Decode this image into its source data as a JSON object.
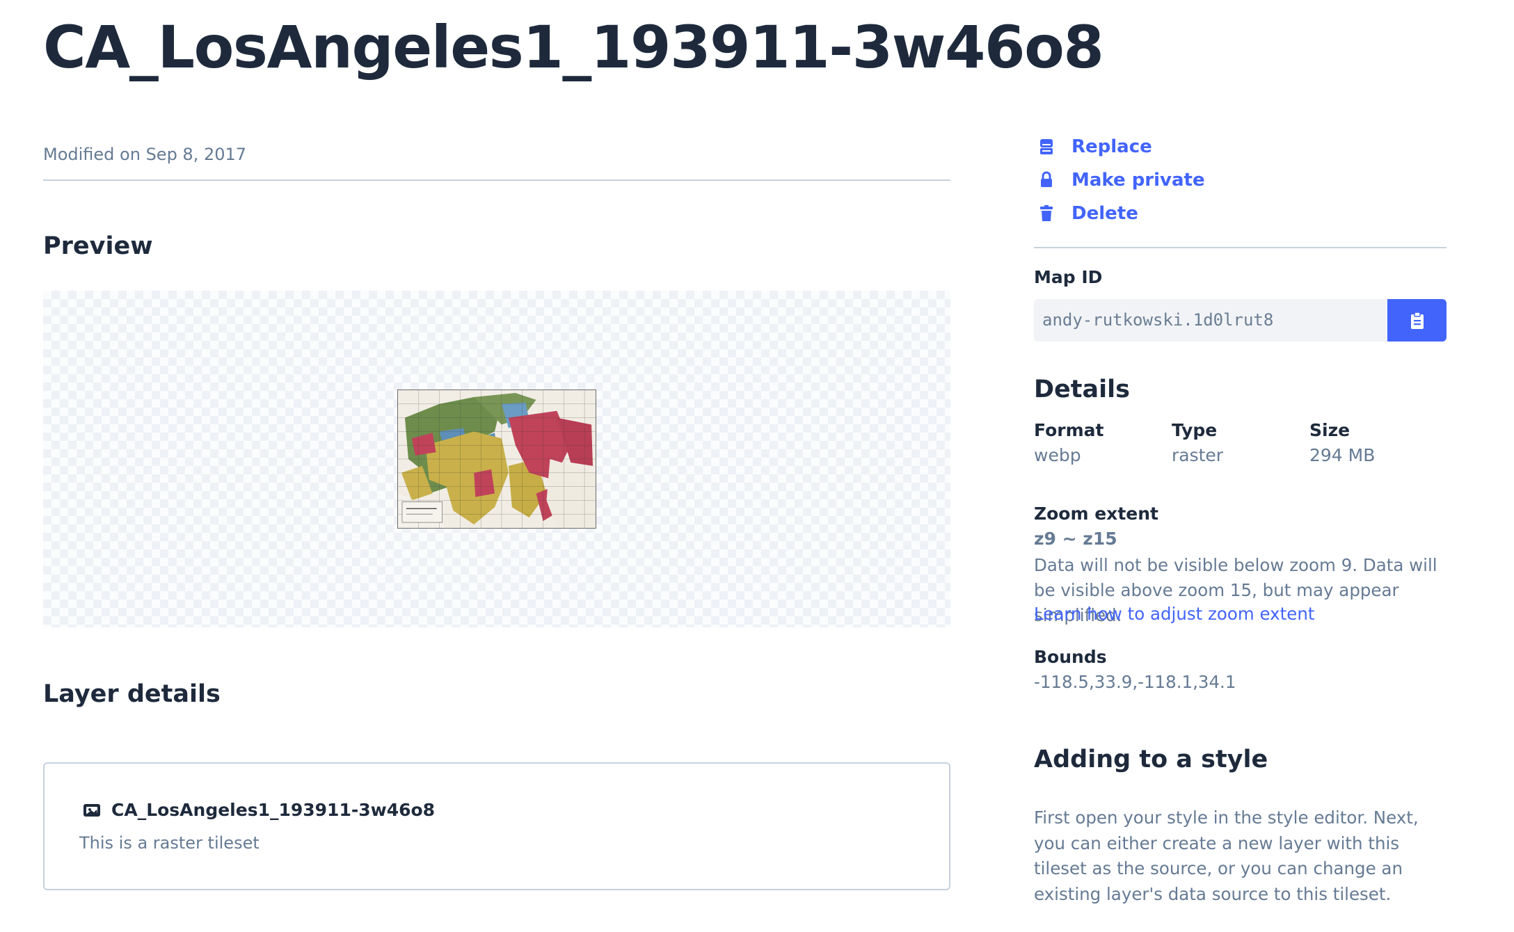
{
  "tileset": {
    "title": "CA_LosAngeles1_193911-3w46o8",
    "modified": "Modified on Sep 8, 2017"
  },
  "preview": {
    "heading": "Preview"
  },
  "layer_details": {
    "heading": "Layer details",
    "layer_name": "CA_LosAngeles1_193911-3w46o8",
    "layer_description": "This is a raster tileset"
  },
  "actions": [
    {
      "label": "Replace",
      "icon": "replace-icon"
    },
    {
      "label": "Make private",
      "icon": "lock-icon"
    },
    {
      "label": "Delete",
      "icon": "trash-icon"
    }
  ],
  "map_id": {
    "label": "Map ID",
    "value": "andy-rutkowski.1d0lrut8",
    "copy_icon": "clipboard-icon"
  },
  "details": {
    "heading": "Details",
    "format_label": "Format",
    "format_value": "webp",
    "type_label": "Type",
    "type_value": "raster",
    "size_label": "Size",
    "size_value": "294 MB",
    "zoom_label": "Zoom extent",
    "zoom_value": "z9 ~ z15",
    "zoom_note": "Data will not be visible below zoom 9. Data will be visible above zoom 15, but may appear simplified.",
    "zoom_link": "Learn how to adjust zoom extent",
    "bounds_label": "Bounds",
    "bounds_value": "-118.5,33.9,-118.1,34.1"
  },
  "adding_to_style": {
    "heading": "Adding to a style",
    "text": "First open your style in the style editor. Next, you can either create a new layer with this tileset as the source, or you can change an existing layer's data source to this tileset."
  },
  "colors": {
    "accent": "#4264fb",
    "text_dark": "#1e2a3c",
    "text_muted": "#657a94",
    "rule": "#c6d1dd"
  }
}
